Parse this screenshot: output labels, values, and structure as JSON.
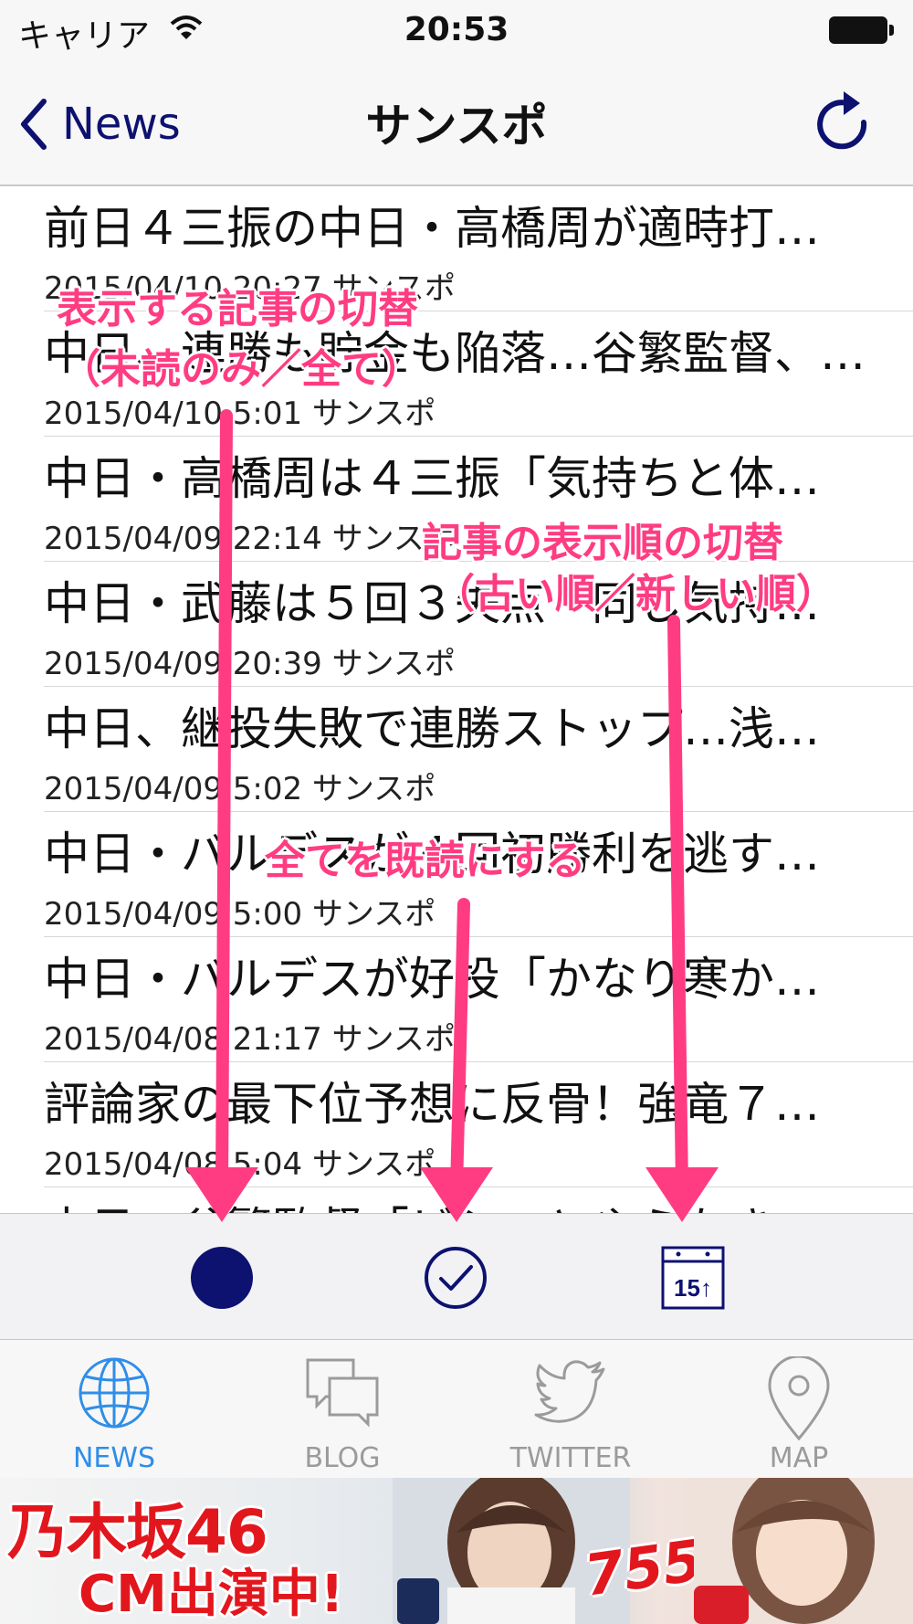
{
  "status_bar": {
    "carrier": "キャリア",
    "time": "20:53"
  },
  "nav": {
    "back_label": "News",
    "title": "サンスポ"
  },
  "articles": [
    {
      "title": "前日４三振の中日・高橋周が適時打…",
      "meta": "2015/04/10 20:27 サンスポ"
    },
    {
      "title": "中日、連勝も貯金も陥落…谷繁監督、…",
      "meta": "2015/04/10 5:01 サンスポ"
    },
    {
      "title": "中日・高橋周は４三振「気持ちと体…",
      "meta": "2015/04/09 22:14 サンスポ"
    },
    {
      "title": "中日・武藤は５回３失点「同じ気持…",
      "meta": "2015/04/09 20:39 サンスポ"
    },
    {
      "title": "中日、継投失敗で連勝ストップ…浅…",
      "meta": "2015/04/09 5:02 サンスポ"
    },
    {
      "title": "中日・バルデスが４回初勝利を逃す…",
      "meta": "2015/04/09 5:00 サンスポ"
    },
    {
      "title": "中日・バルデスが好投「かなり寒か…",
      "meta": "2015/04/08 21:17 サンスポ"
    },
    {
      "title": "評論家の最下位予想に反骨！強竜７…",
      "meta": "2015/04/08 5:04 サンスポ"
    },
    {
      "title": "中日・谷繁監督「ビシッとやらなき…",
      "meta": ""
    }
  ],
  "toolbar": {
    "unread_toggle_icon": "filled-circle-icon",
    "mark_all_read_icon": "check-circle-icon",
    "sort_order_icon": "calendar-15-up-icon",
    "calendar_day": "15↑"
  },
  "tabs": [
    {
      "label": "NEWS",
      "icon": "globe-icon",
      "active": true
    },
    {
      "label": "BLOG",
      "icon": "chat-bubbles-icon",
      "active": false
    },
    {
      "label": "TWITTER",
      "icon": "twitter-bird-icon",
      "active": false
    },
    {
      "label": "MAP",
      "icon": "map-pin-icon",
      "active": false
    }
  ],
  "ad": {
    "line1": "乃木坂46",
    "line2": "CM出演中!",
    "badge": "755"
  },
  "annotations": {
    "toggle_label_1": "表示する記事の切替",
    "toggle_label_2": "（未読のみ／全て）",
    "sort_label_1": "記事の表示順の切替",
    "sort_label_2": "（古い順／新しい順）",
    "mark_read_label": "全てを既読にする"
  },
  "colors": {
    "nav_tint": "#0d1170",
    "tab_active": "#2f8ee8",
    "tab_inactive": "#9b9b9b",
    "annotation": "#ff3c82",
    "ad_red": "#e2171d"
  }
}
